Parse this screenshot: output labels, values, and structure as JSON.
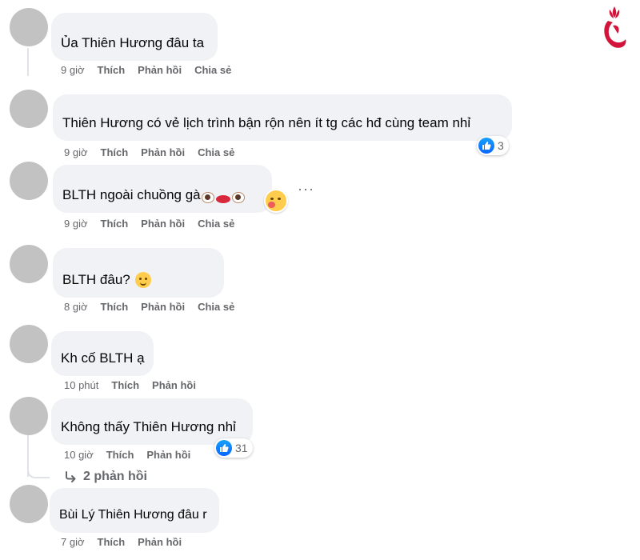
{
  "colors": {
    "bubble": "#f0f2f5",
    "meta": "#65676b",
    "like": "#0866ff",
    "logo": "#d2143a"
  },
  "comments": [
    {
      "text": "Ủa Thiên Hương đâu ta",
      "time": "9 giờ",
      "actions": [
        "Thích",
        "Phản hồi",
        "Chia sẻ"
      ]
    },
    {
      "text": "Thiên Hương có vẻ lịch trình bận rộn nên ít tg các hđ cùng team nhỉ",
      "time": "9 giờ",
      "actions": [
        "Thích",
        "Phản hồi",
        "Chia sẻ"
      ],
      "reactions": "3"
    },
    {
      "text": "BLTH ngoài chuồng gà",
      "time": "9 giờ",
      "actions": [
        "Thích",
        "Phản hồi",
        "Chia sẻ"
      ],
      "more": "···"
    },
    {
      "text": "BLTH đâu?",
      "time": "8 giờ",
      "actions": [
        "Thích",
        "Phản hồi",
        "Chia sẻ"
      ]
    },
    {
      "text": "Kh cố BLTH ạ",
      "time": "10 phút",
      "actions": [
        "Thích",
        "Phản hồi"
      ]
    },
    {
      "text": "Không thấy Thiên Hương nhỉ",
      "time": "10 giờ",
      "actions": [
        "Thích",
        "Phản hồi"
      ],
      "reactions": "31",
      "replies": "2 phản hồi"
    },
    {
      "text": "Bùi Lý Thiên Hương đâu r",
      "time": "7 giờ",
      "actions": [
        "Thích",
        "Phản hồi"
      ]
    }
  ]
}
